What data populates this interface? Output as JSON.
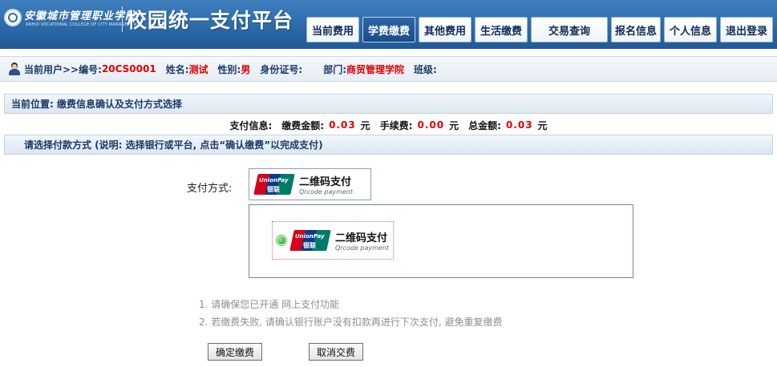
{
  "header": {
    "school_name": "安徽城市管理职业学院",
    "school_name_en": "ANHUI VOCATIONAL COLLEGE OF CITY MANAGEMENT",
    "platform_title": "校园统一支付平台",
    "nav": [
      {
        "label": "当前费用",
        "active": false
      },
      {
        "label": "学费缴费",
        "active": true
      },
      {
        "label": "其他费用",
        "active": false
      },
      {
        "label": "生活缴费",
        "active": false
      },
      {
        "label": "交易查询",
        "active": false
      },
      {
        "label": "报名信息",
        "active": false
      },
      {
        "label": "个人信息",
        "active": false
      },
      {
        "label": "退出登录",
        "active": false
      }
    ]
  },
  "user": {
    "prefix": "当前用户>>",
    "id_label": "编号:",
    "id_value": "20CS0001",
    "name_label": "姓名:",
    "name_value": "测试",
    "gender_label": "性别:",
    "gender_value": "男",
    "idcard_label": "身份证号:",
    "idcard_value": "",
    "dept_label": "部门:",
    "dept_value": "商贸管理学院",
    "class_label": "班级:",
    "class_value": ""
  },
  "location": "当前位置: 缴费信息确认及支付方式选择",
  "payinfo": {
    "label": "支付信息:",
    "fee_label": "缴费金额:",
    "fee_value": "0.03",
    "service_label": "手续费:",
    "service_value": "0.00",
    "total_label": "总金额:",
    "total_value": "0.03",
    "unit": "元"
  },
  "choose_text": "请选择付款方式 (说明: 选择银行或平台, 点击“确认缴费”以完成支付)",
  "method": {
    "label": "支付方式:",
    "logo_en": "UnionPay",
    "logo_cn": "银联",
    "name": "二维码支付",
    "name_en": "Qrcode payment"
  },
  "notes": [
    "1. 请确保您已开通 网上支付功能",
    "2. 若缴费失败, 请确认银行账户没有扣款再进行下次支付, 避免重复缴费"
  ],
  "buttons": {
    "confirm": "确定缴费",
    "cancel": "取消交费"
  },
  "colors": {
    "header_blue": "#2c6aa8",
    "active_tab": "#1b4d86",
    "highlight_red": "#e00000"
  }
}
